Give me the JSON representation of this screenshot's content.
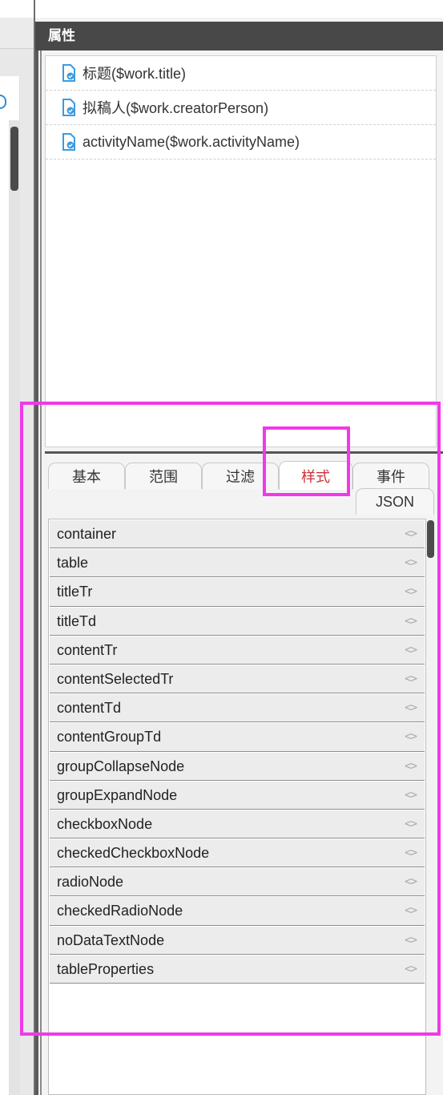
{
  "panel": {
    "title": "属性"
  },
  "fields": [
    {
      "label": "标题($work.title)"
    },
    {
      "label": "拟稿人($work.creatorPerson)"
    },
    {
      "label": "activityName($work.activityName)"
    }
  ],
  "tabs": [
    {
      "label": "基本"
    },
    {
      "label": "范围"
    },
    {
      "label": "过滤"
    },
    {
      "label": "样式",
      "active": true
    },
    {
      "label": "事件"
    },
    {
      "label": "JSON"
    }
  ],
  "style_items": [
    "container",
    "table",
    "titleTr",
    "titleTd",
    "contentTr",
    "contentSelectedTr",
    "contentTd",
    "contentGroupTd",
    "groupCollapseNode",
    "groupExpandNode",
    "checkboxNode",
    "checkedCheckboxNode",
    "radioNode",
    "checkedRadioNode",
    "noDataTextNode",
    "tableProperties"
  ],
  "icons": {
    "field": "document-check-icon",
    "style_code": "code-brackets-icon"
  },
  "colors": {
    "highlight": "#f039e8",
    "active_tab": "#c9343c",
    "header_bg": "#484848"
  },
  "code_glyph": "<>"
}
